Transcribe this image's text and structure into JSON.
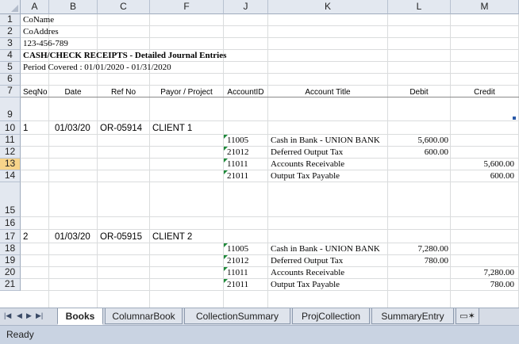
{
  "columns": [
    "A",
    "B",
    "C",
    "F",
    "J",
    "K",
    "L",
    "M"
  ],
  "rows": [
    "1",
    "2",
    "3",
    "4",
    "5",
    "6",
    "7",
    "9",
    "10",
    "11",
    "12",
    "13",
    "14",
    "15",
    "16",
    "17",
    "18",
    "19",
    "20",
    "21"
  ],
  "header_lines": {
    "company": "CoName",
    "address": "CoAddres",
    "tin": "123-456-789",
    "title": "CASH/CHECK RECEIPTS  - Detailed Journal Entries",
    "period": "Period Covered :  01/01/2020 - 01/31/2020"
  },
  "table_headers": {
    "seqno": "SeqNo",
    "date": "Date",
    "refno": "Ref No",
    "payor": "Payor / Project",
    "accountid": "AccountID",
    "title": "Account Title",
    "debit": "Debit",
    "credit": "Credit"
  },
  "entries": [
    {
      "seq": "1",
      "date": "01/03/20",
      "ref": "OR-05914",
      "payor": "CLIENT 1",
      "lines": [
        {
          "id": "11005",
          "title": "Cash in Bank - UNION BANK",
          "debit": "5,600.00",
          "credit": ""
        },
        {
          "id": "21012",
          "title": "Deferred Output Tax",
          "debit": "600.00",
          "credit": ""
        },
        {
          "id": "11011",
          "title": "Accounts Receivable",
          "debit": "",
          "credit": "5,600.00"
        },
        {
          "id": "21011",
          "title": "Output Tax Payable",
          "debit": "",
          "credit": "600.00"
        }
      ]
    },
    {
      "seq": "2",
      "date": "01/03/20",
      "ref": "OR-05915",
      "payor": "CLIENT 2",
      "lines": [
        {
          "id": "11005",
          "title": "Cash in Bank - UNION BANK",
          "debit": "7,280.00",
          "credit": ""
        },
        {
          "id": "21012",
          "title": "Deferred Output Tax",
          "debit": "780.00",
          "credit": ""
        },
        {
          "id": "11011",
          "title": "Accounts Receivable",
          "debit": "",
          "credit": "7,280.00"
        },
        {
          "id": "21011",
          "title": "Output Tax Payable",
          "debit": "",
          "credit": "780.00"
        }
      ]
    }
  ],
  "sheet_tabs": [
    "Books",
    "ColumnarBook",
    "CollectionSummary",
    "ProjCollection",
    "SummaryEntry"
  ],
  "active_tab": "Books",
  "status": "Ready",
  "colors": {
    "header_bg": "#e3e8f0",
    "selected_header": "#f7d48a",
    "gridline": "#dadcdd",
    "note_tag": "#1f8a3a"
  }
}
